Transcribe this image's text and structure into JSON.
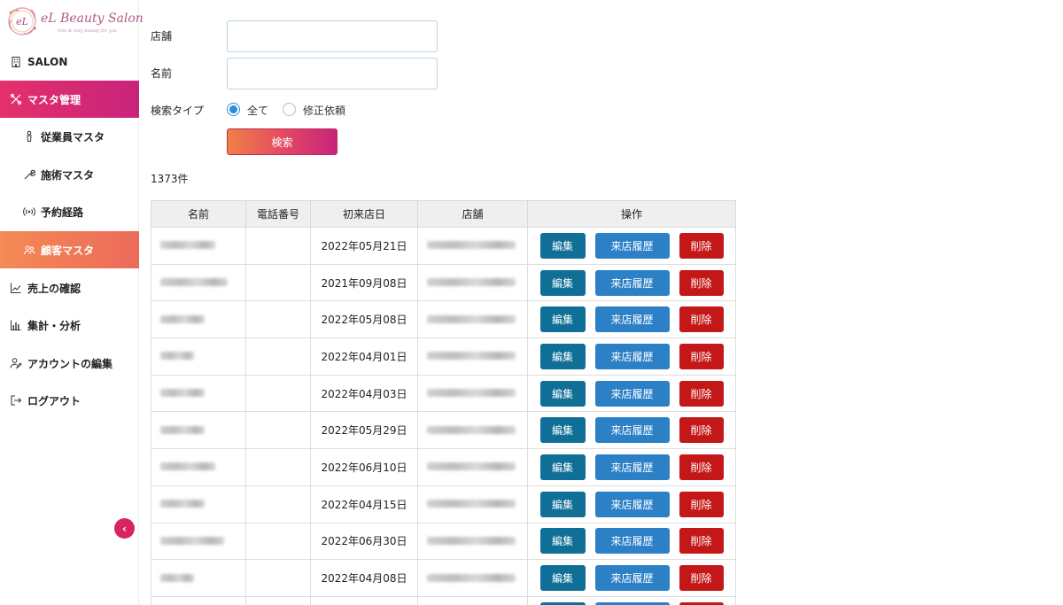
{
  "app": {
    "logo_title": "eL Beauty Salon",
    "logo_tagline": "One & only beauty for you",
    "logo_mark": "eL"
  },
  "sidebar": {
    "items": [
      {
        "label": "SALON",
        "icon": "building-icon"
      },
      {
        "label": "マスタ管理",
        "icon": "tools-icon"
      },
      {
        "label": "従業員マスタ",
        "icon": "person-icon"
      },
      {
        "label": "施術マスタ",
        "icon": "wrench-icon"
      },
      {
        "label": "予約経路",
        "icon": "signal-icon"
      },
      {
        "label": "顧客マスタ",
        "icon": "users-icon"
      },
      {
        "label": "売上の確認",
        "icon": "line-chart-icon"
      },
      {
        "label": "集計・分析",
        "icon": "bar-chart-icon"
      },
      {
        "label": "アカウントの編集",
        "icon": "user-edit-icon"
      },
      {
        "label": "ログアウト",
        "icon": "logout-icon"
      }
    ],
    "collapse_icon": "chevron-left-icon"
  },
  "search": {
    "shop_label": "店舗",
    "shop_value": "",
    "name_label": "名前",
    "name_value": "",
    "type_label": "検索タイプ",
    "type_options": [
      "全て",
      "修正依頼"
    ],
    "type_selected": "全て",
    "submit_label": "検索"
  },
  "result_count": "1373件",
  "table": {
    "headers": [
      "名前",
      "電話番号",
      "初来店日",
      "店舗",
      "操作"
    ],
    "rows": [
      {
        "first_visit": "2022年05月21日"
      },
      {
        "first_visit": "2021年09月08日"
      },
      {
        "first_visit": "2022年05月08日"
      },
      {
        "first_visit": "2022年04月01日"
      },
      {
        "first_visit": "2022年04月03日"
      },
      {
        "first_visit": "2022年05月29日"
      },
      {
        "first_visit": "2022年06月10日"
      },
      {
        "first_visit": "2022年04月15日"
      },
      {
        "first_visit": "2022年06月30日"
      },
      {
        "first_visit": "2022年04月08日"
      },
      {
        "first_visit": ""
      }
    ],
    "actions": {
      "edit": "編集",
      "visits": "来店履歴",
      "delete": "削除"
    }
  },
  "colors": {
    "accent": "#d8245f",
    "edit_button": "#0f6f97",
    "visit_button": "#2c80c6",
    "delete_button": "#c41717"
  }
}
